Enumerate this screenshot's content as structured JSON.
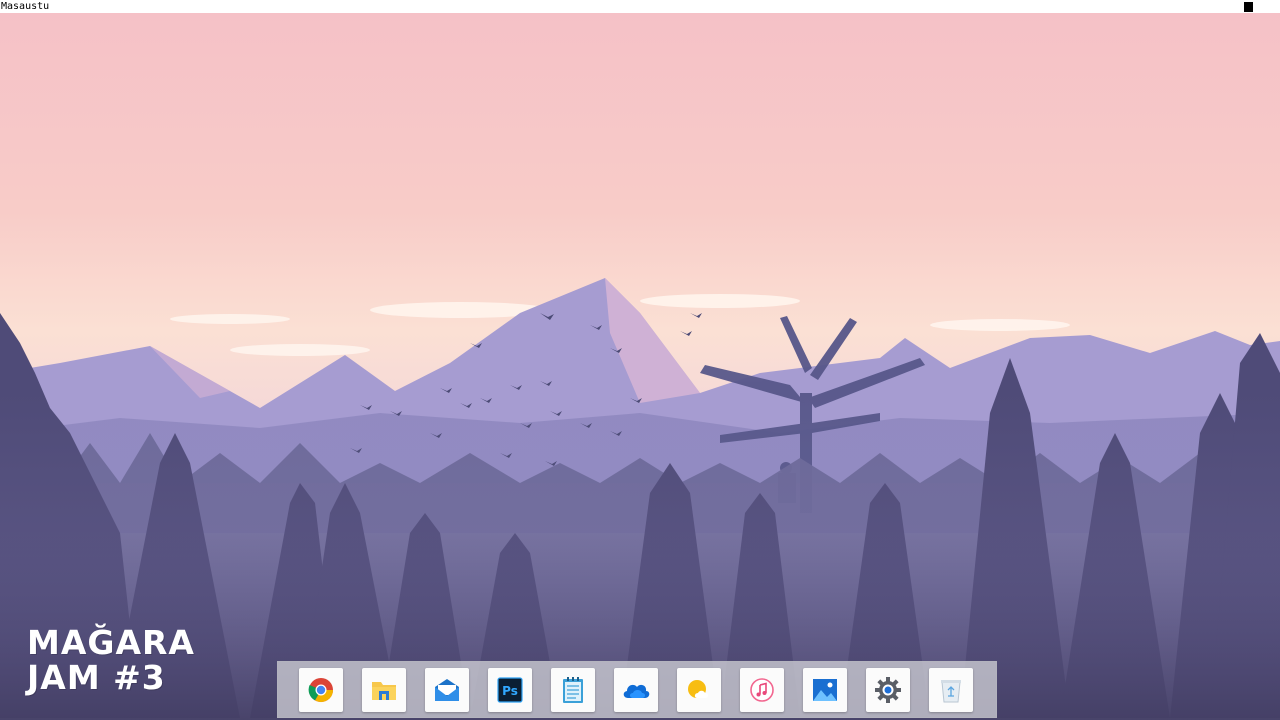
{
  "topbar": {
    "title": "Masaustu",
    "indicator_icon": "square-indicator-icon"
  },
  "logo": {
    "line1": "MAĞARA",
    "line2": "JAM #3"
  },
  "dock": {
    "items": [
      {
        "name": "chrome",
        "icon": "chrome-icon"
      },
      {
        "name": "file-explorer",
        "icon": "folder-icon"
      },
      {
        "name": "mail",
        "icon": "mail-icon"
      },
      {
        "name": "photoshop",
        "icon": "photoshop-icon",
        "label": "Ps"
      },
      {
        "name": "notepad",
        "icon": "notepad-icon"
      },
      {
        "name": "onedrive",
        "icon": "cloud-icon"
      },
      {
        "name": "weather",
        "icon": "weather-icon"
      },
      {
        "name": "music",
        "icon": "music-icon"
      },
      {
        "name": "photos",
        "icon": "photos-icon"
      },
      {
        "name": "settings",
        "icon": "gear-icon"
      },
      {
        "name": "recycle-bin",
        "icon": "recycle-bin-icon"
      }
    ]
  },
  "colors": {
    "sky_top": "#f6c3c8",
    "sky_horizon": "#fbe1d4",
    "mountain": "#9e94c8",
    "forest": "#5a5683",
    "dock_bg": "#cdcdd4"
  }
}
